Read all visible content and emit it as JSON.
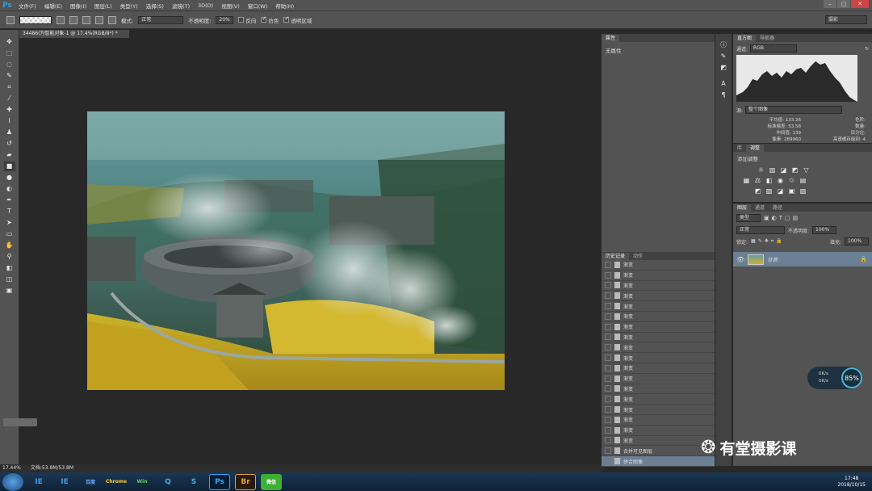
{
  "app": {
    "logo": "Ps"
  },
  "menu": [
    "文件(F)",
    "编辑(E)",
    "图像(I)",
    "图层(L)",
    "类型(Y)",
    "选择(S)",
    "滤镜(T)",
    "3D(D)",
    "视图(V)",
    "窗口(W)",
    "帮助(H)"
  ],
  "options": {
    "mode_label": "模式:",
    "mode_value": "正常",
    "opacity_label": "不透明度:",
    "opacity_value": "20%",
    "reverse_label": "反向",
    "dither_label": "仿色",
    "transparency_label": "透明区域",
    "dither_checked": true,
    "transparency_checked": true,
    "workspace": "摄影"
  },
  "document": {
    "tab_title": "34486(为智能对象-1 @ 17.4%(RGB/8*) *",
    "zoom": "17.44%",
    "doc_size": "文档:53.8M/53.8M"
  },
  "properties": {
    "tabs": [
      "属性"
    ],
    "content": "无属性"
  },
  "histogram": {
    "tabs": [
      "直方图",
      "导航器"
    ],
    "channel_label": "通道:",
    "channel_value": "RGB",
    "source_label": "源:",
    "source_value": "整个图像",
    "stats": [
      {
        "label": "平均值:",
        "value": "133.26"
      },
      {
        "label": "标准偏差:",
        "value": "53.58"
      },
      {
        "label": "中间值:",
        "value": "139"
      },
      {
        "label": "像素:",
        "value": "289960"
      }
    ],
    "stats_right": [
      {
        "label": "色阶:",
        "value": ""
      },
      {
        "label": "数量:",
        "value": ""
      },
      {
        "label": "百分位:",
        "value": ""
      },
      {
        "label": "高速缓存级别:",
        "value": "4"
      }
    ]
  },
  "adjustments": {
    "tabs": [
      "库",
      "调整"
    ],
    "title": "添加调整"
  },
  "layers": {
    "tabs": [
      "图层",
      "通道",
      "路径"
    ],
    "filter_value": "类型",
    "blend_value": "正常",
    "opacity_label": "不透明度:",
    "opacity_value": "100%",
    "lock_label": "锁定:",
    "fill_label": "填充:",
    "fill_value": "100%",
    "items": [
      {
        "name": "背景"
      }
    ]
  },
  "history": {
    "tabs": [
      "历史记录",
      "动作"
    ],
    "items": [
      "渐变",
      "渐变",
      "渐变",
      "渐变",
      "渐变",
      "渐变",
      "渐变",
      "渐变",
      "渐变",
      "渐变",
      "渐变",
      "渐变",
      "渐变",
      "渐变",
      "渐变",
      "渐变",
      "渐变",
      "渐变"
    ],
    "merge_item": "合并可见图层",
    "selected_item": "拼合图像"
  },
  "taskbar": {
    "apps": [
      "IE",
      "IE",
      "百度",
      "Chrome",
      "Win",
      "Q",
      "S",
      "Ps",
      "Br",
      "微信"
    ],
    "time": "17:48",
    "date": "2018/10/15"
  },
  "speed_widget": {
    "percent": "85%",
    "up": "0K/s",
    "down": "0K/s"
  },
  "watermark": "有堂摄影课"
}
